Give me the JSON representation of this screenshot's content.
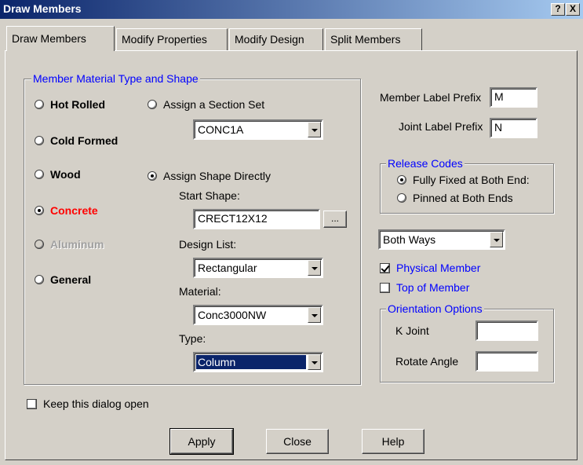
{
  "window": {
    "title": "Draw Members",
    "help_btn": "?",
    "close_btn": "X"
  },
  "tabs": [
    {
      "label": "Draw Members",
      "active": true
    },
    {
      "label": "Modify Properties",
      "active": false
    },
    {
      "label": "Modify Design",
      "active": false
    },
    {
      "label": "Split Members",
      "active": false
    }
  ],
  "material_group": {
    "legend": "Member Material Type and Shape",
    "materials": [
      {
        "label": "Hot Rolled",
        "selected": false,
        "enabled": true
      },
      {
        "label": "Cold Formed",
        "selected": false,
        "enabled": true
      },
      {
        "label": "Wood",
        "selected": false,
        "enabled": true
      },
      {
        "label": "Concrete",
        "selected": true,
        "enabled": true
      },
      {
        "label": "Aluminum",
        "selected": false,
        "enabled": false
      },
      {
        "label": "General",
        "selected": false,
        "enabled": true
      }
    ],
    "assign_section_set": {
      "label": "Assign a Section Set",
      "selected": false
    },
    "section_set_value": "CONC1A",
    "assign_shape_directly": {
      "label": "Assign Shape Directly",
      "selected": true
    },
    "start_shape_label": "Start Shape:",
    "start_shape_value": "CRECT12X12",
    "browse_label": "...",
    "design_list_label": "Design List:",
    "design_list_value": "Rectangular",
    "material_label": "Material:",
    "material_value": "Conc3000NW",
    "type_label": "Type:",
    "type_value": "Column"
  },
  "labels": {
    "member_prefix_label": "Member Label Prefix",
    "member_prefix_value": "M",
    "joint_prefix_label": "Joint Label Prefix",
    "joint_prefix_value": "N"
  },
  "release_codes": {
    "legend": "Release Codes",
    "options": [
      {
        "label": "Fully Fixed at Both End:",
        "selected": true
      },
      {
        "label": "Pinned at Both Ends",
        "selected": false
      }
    ]
  },
  "direction_value": "Both Ways",
  "physical_member": {
    "label": "Physical Member",
    "checked": true
  },
  "top_of_member": {
    "label": "Top of Member",
    "checked": false
  },
  "orientation": {
    "legend": "Orientation Options",
    "k_joint_label": "K Joint",
    "k_joint_value": "",
    "rotate_label": "Rotate Angle",
    "rotate_value": ""
  },
  "keep_open": {
    "label": "Keep this dialog open",
    "checked": false
  },
  "buttons": {
    "apply": "Apply",
    "close": "Close",
    "help": "Help"
  }
}
